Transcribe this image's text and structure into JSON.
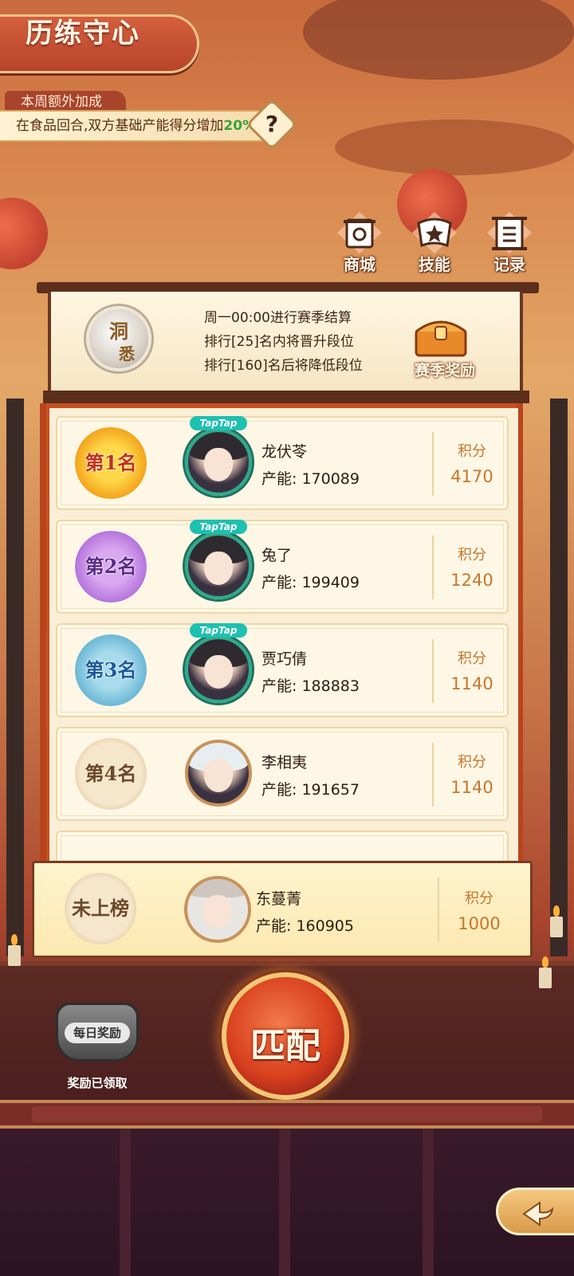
{
  "title": "历练守心",
  "bonus": {
    "tag": "本周额外加成",
    "text": "在食品回合,双方基础产能得分增加",
    "percent": "20%",
    "help_symbol": "?"
  },
  "top_buttons": [
    {
      "label": "商城",
      "icon": "shop-icon"
    },
    {
      "label": "技能",
      "icon": "skill-icon"
    },
    {
      "label": "记录",
      "icon": "record-icon"
    }
  ],
  "season": {
    "tier_line1": "洞",
    "tier_line2": "悉",
    "lines": [
      "周一00:00进行赛季结算",
      "排行[25]名内将晋升段位",
      "排行[160]名后将降低段位"
    ],
    "reward_label": "赛季奖励"
  },
  "ranking": [
    {
      "rank": "第1名",
      "name": "龙伏苓",
      "production": "产能: 170089",
      "score_label": "积分",
      "score": "4170",
      "taptap": "TapTap"
    },
    {
      "rank": "第2名",
      "name": "兔了",
      "production": "产能: 199409",
      "score_label": "积分",
      "score": "1240",
      "taptap": "TapTap"
    },
    {
      "rank": "第3名",
      "name": "贾巧倩",
      "production": "产能: 188883",
      "score_label": "积分",
      "score": "1140",
      "taptap": "TapTap"
    },
    {
      "rank": "第4名",
      "name": "李相夷",
      "production": "产能: 191657",
      "score_label": "积分",
      "score": "1140"
    }
  ],
  "me": {
    "rank": "未上榜",
    "name": "东蔓菁",
    "production": "产能: 160905",
    "score_label": "积分",
    "score": "1000"
  },
  "daily_reward": {
    "pot_label": "每日奖励",
    "status": "奖励已领取"
  },
  "match_label": "匹配",
  "colors": {
    "accent": "#d8401e",
    "score": "#c8752c",
    "bonus_percent": "#36a33a"
  }
}
